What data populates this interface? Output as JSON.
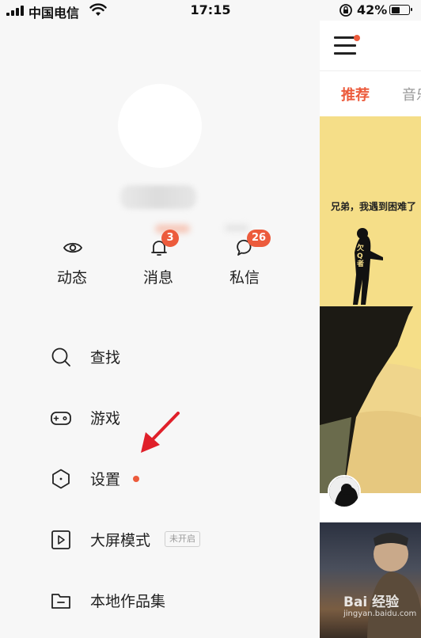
{
  "status_bar": {
    "carrier": "中国电信",
    "time": "17:15",
    "battery_percent": "42%",
    "battery_level": 0.42
  },
  "profile": {
    "avatar_icon": "avatar-placeholder",
    "username_blurred": true
  },
  "quick_actions": [
    {
      "label": "动态",
      "icon": "eye-icon"
    },
    {
      "label": "消息",
      "icon": "bell-icon",
      "badge": "3"
    },
    {
      "label": "私信",
      "icon": "chat-bubble-icon",
      "badge": "26"
    }
  ],
  "menu": [
    {
      "label": "查找",
      "icon": "search-icon"
    },
    {
      "label": "游戏",
      "icon": "gamepad-icon"
    },
    {
      "label": "设置",
      "icon": "hexagon-settings-icon",
      "has_dot": true
    },
    {
      "label": "大屏模式",
      "icon": "play-screen-icon",
      "tag": "未开启"
    },
    {
      "label": "本地作品集",
      "icon": "folder-icon"
    }
  ],
  "main_panel": {
    "tabs": [
      {
        "label": "推荐",
        "active": true
      },
      {
        "label": "音乐",
        "active": false
      }
    ],
    "card_caption": "兄弟，我遇到困难了",
    "figure_text": "欠Q者"
  },
  "watermark": {
    "text": "Bai  经验",
    "sub": "jingyan.baidu.com"
  },
  "colors": {
    "accent": "#ec5b3c",
    "background": "#f7f7f7"
  }
}
